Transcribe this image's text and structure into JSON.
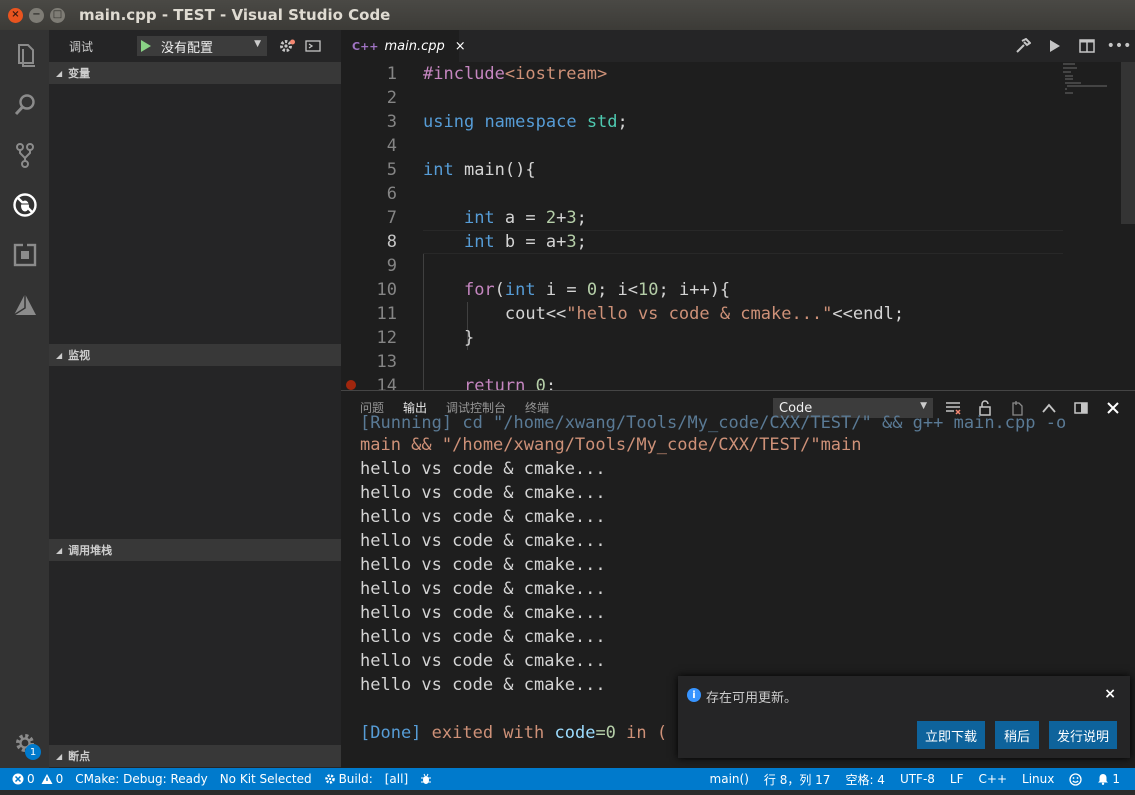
{
  "window": {
    "title": "main.cpp - TEST - Visual Studio Code"
  },
  "sidebar": {
    "debug_label": "调试",
    "config_select": "没有配置",
    "sections": [
      "变量",
      "监视",
      "调用堆栈",
      "断点"
    ]
  },
  "activity": {
    "badge": "1"
  },
  "editor": {
    "tab_icon": "C++",
    "tab_name": "main.cpp",
    "tab_close": "×",
    "line_numbers": [
      "1",
      "2",
      "3",
      "4",
      "5",
      "6",
      "7",
      "8",
      "9",
      "10",
      "11",
      "12",
      "13",
      "14"
    ],
    "current_line": "8"
  },
  "panel": {
    "tabs": [
      "问题",
      "输出",
      "调试控制台",
      "终端"
    ],
    "active_tab": "输出",
    "output_select": "Code",
    "lines": [
      "[Running] cd \"/home/xwang/Tools/My_code/CXX/TEST/\" && g++ main.cpp -o",
      "main && \"/home/xwang/Tools/My_code/CXX/TEST/\"main",
      "hello vs code & cmake...",
      "hello vs code & cmake...",
      "hello vs code & cmake...",
      "hello vs code & cmake...",
      "hello vs code & cmake...",
      "hello vs code & cmake...",
      "hello vs code & cmake...",
      "hello vs code & cmake...",
      "hello vs code & cmake...",
      "hello vs code & cmake..."
    ],
    "done_tag": "[Done]",
    "done_text": " exited with ",
    "done_code_key": "code",
    "done_eq": "=0",
    "done_in": " in ("
  },
  "notification": {
    "message": "存在可用更新。",
    "close": "×",
    "buttons": [
      "立即下载",
      "稍后",
      "发行说明"
    ]
  },
  "statusbar": {
    "errors": "0",
    "warnings": "0",
    "cmake": "CMake: Debug: Ready",
    "kit": "No Kit Selected",
    "build": "Build:",
    "target": "[all]",
    "scope": "main()",
    "position": "行 8，列 17",
    "spaces": "空格: 4",
    "encoding": "UTF-8",
    "eol": "LF",
    "language": "C++",
    "platform": "Linux",
    "notifications": "1"
  },
  "colors": {
    "accent": "#007acc",
    "activity_bar": "#333333",
    "sidebar": "#252526",
    "editor_bg": "#1e1e1e"
  }
}
